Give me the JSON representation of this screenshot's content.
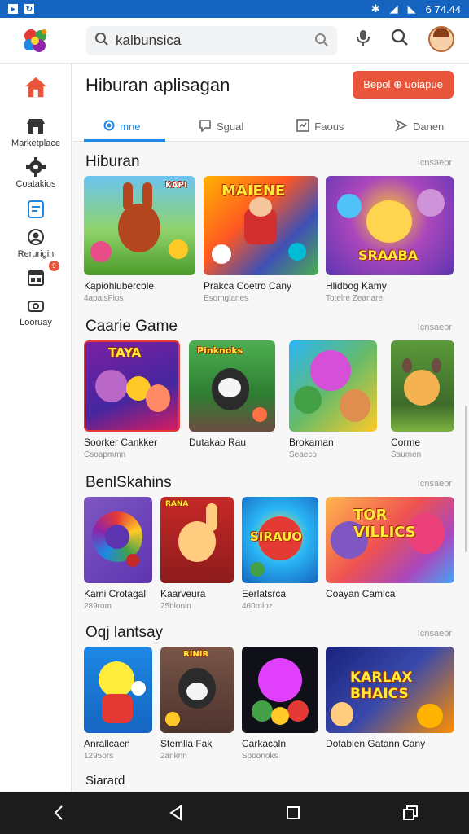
{
  "statusbar": {
    "time": "6 74.44"
  },
  "search": {
    "value": "kalbunsica"
  },
  "sidebar": {
    "items": [
      {
        "label": "",
        "icon": "home-icon"
      },
      {
        "label": "Marketplace",
        "icon": "store-icon"
      },
      {
        "label": "Coatakios",
        "icon": "gear-icon"
      },
      {
        "label": "",
        "icon": "document-icon",
        "badge": ""
      },
      {
        "label": "Rerurigin",
        "icon": "account-icon"
      },
      {
        "label": "",
        "icon": "calendar-icon",
        "badge": "9"
      },
      {
        "label": "Looruay",
        "icon": "camera-icon"
      }
    ]
  },
  "header": {
    "title": "Hiburan aplisagan",
    "primary_button": "Bepol ⊕ uoiapue",
    "tabs": [
      "mne",
      "Sgual",
      "Faous",
      "Danen"
    ]
  },
  "sections": [
    {
      "title": "Hiburan",
      "more": "Icnsaeor",
      "items": [
        {
          "title": "Kapiohlubercble",
          "sub": "4apaisFios",
          "art": "KAPI"
        },
        {
          "title": "Prakca Coetro Cany",
          "sub": "Esomglanes",
          "art": "MAIENE"
        },
        {
          "title": "Hlidbog Kamy",
          "sub": "Totelre Zeanare",
          "art": "SRAABA"
        }
      ]
    },
    {
      "title": "Caarie Game",
      "more": "Icnsaeor",
      "items": [
        {
          "title": "Soorker Cankker",
          "sub": "Csoapmmn",
          "art": "TAYA"
        },
        {
          "title": "Dutakao Rau",
          "sub": "",
          "art": "Pinknoks"
        },
        {
          "title": "Brokaman",
          "sub": "Seaeco",
          "art": ""
        },
        {
          "title": "Corme",
          "sub": "Saumen",
          "art": ""
        }
      ]
    },
    {
      "title": "BenlSkahins",
      "more": "Icnsaeor",
      "items": [
        {
          "title": "Kami Crotagal",
          "sub": "289rom",
          "art": ""
        },
        {
          "title": "Kaarveura",
          "sub": "25blonin",
          "art": "RANA"
        },
        {
          "title": "Eerlatsrca",
          "sub": "460mloz",
          "art": "SIRAUO"
        },
        {
          "title": "Coayan Camlca",
          "sub": "",
          "art": "TOR VILLICS"
        }
      ]
    },
    {
      "title": "Oqj lantsay",
      "more": "Icnsaeor",
      "items": [
        {
          "title": "Anrallcaen",
          "sub": "1295ors",
          "art": ""
        },
        {
          "title": "Stemlla Fak",
          "sub": "2anknn",
          "art": "RINIR"
        },
        {
          "title": "Carkacaln",
          "sub": "Sooonoks",
          "art": ""
        },
        {
          "title": "Dotablen Gatann Cany",
          "sub": "",
          "art": "KARLAX BHAICS"
        }
      ]
    },
    {
      "title": "Siarard",
      "more": "",
      "items": []
    }
  ],
  "colors": {
    "accent": "#1e88e5",
    "primary_button": "#e8553a",
    "status_bar": "#1565c0"
  }
}
